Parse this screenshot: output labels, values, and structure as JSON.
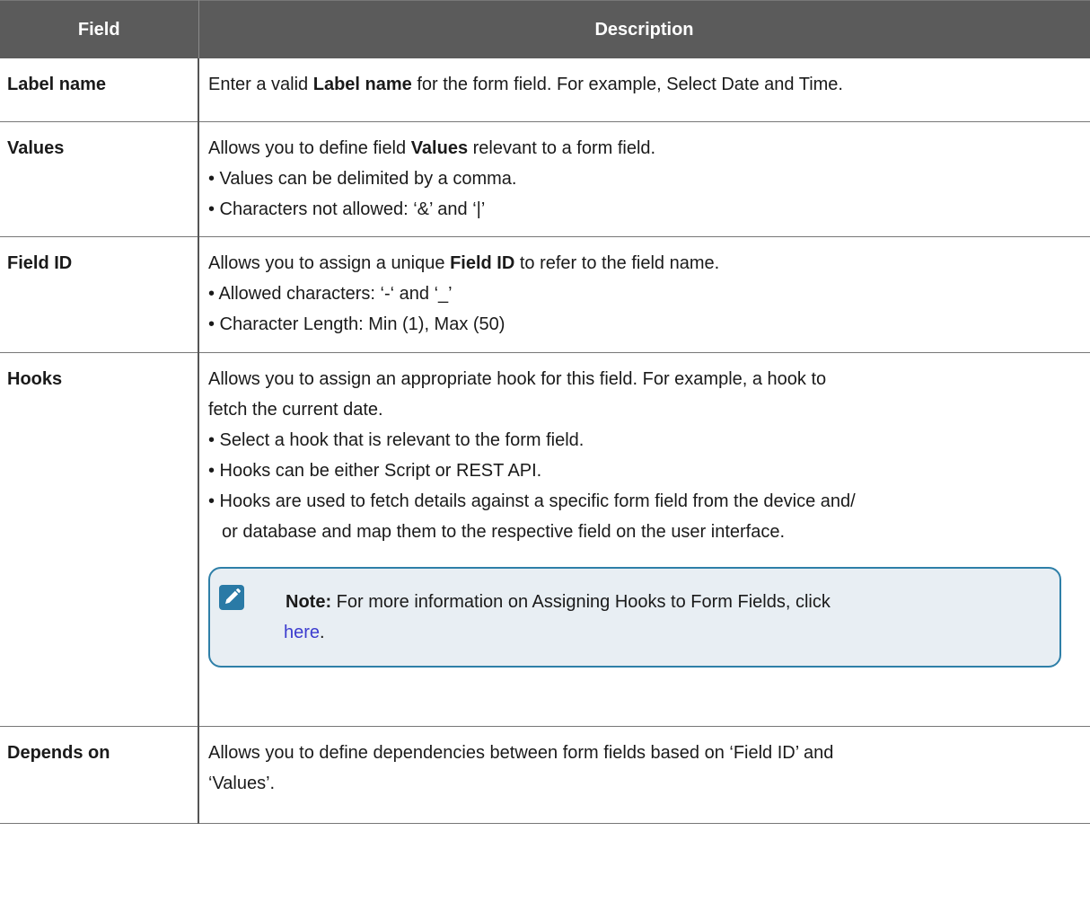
{
  "table": {
    "headers": [
      "Field",
      "Description"
    ],
    "rows": {
      "label_name": {
        "field": "Label name",
        "d_pre": "Enter a valid ",
        "d_bold": "Label name",
        "d_post": " for the form field. For example, Select Date and Time."
      },
      "values": {
        "field": "Values",
        "d_pre": "Allows you to define field ",
        "d_bold": "Values",
        "d_post": " relevant to a form field.",
        "bullets": [
          "• Values can be delimited by a comma.",
          "• Characters not allowed: ‘&’ and ‘|’"
        ]
      },
      "field_id": {
        "field": "Field ID",
        "d_pre": "Allows you to assign a unique ",
        "d_bold": "Field ID",
        "d_post": " to refer to the field name.",
        "bullets": [
          "• Allowed characters: ‘-‘ and ‘_’",
          "• Character Length: Min (1), Max (50)"
        ]
      },
      "hooks": {
        "field": "Hooks",
        "d_line1": "Allows you to assign an appropriate hook for this field. For example, a hook to",
        "d_line2": "fetch the current date.",
        "bullets": [
          "• Select a hook that is relevant to the form field.",
          "• Hooks can be either Script or REST API.",
          "• Hooks are used to fetch details against a specific form field from the device and/"
        ],
        "bullet3_cont": "or database and map them to the respective field on the user interface.",
        "note": {
          "label": "Note:",
          "text": " For more information on Assigning Hooks to Form Fields, click",
          "link": "here",
          "after_link": "."
        }
      },
      "depends_on": {
        "field": "Depends on",
        "d_line1": "Allows you to define dependencies between form fields based on ‘Field ID’ and",
        "d_line2": "‘Values’."
      }
    }
  },
  "colors": {
    "header_bg": "#5b5b5b",
    "note_border": "#2e7fa8",
    "note_bg": "#e8eef3",
    "note_icon": "#2a7aa6",
    "link": "#3c3ccf"
  },
  "icons": {
    "note": "pencil-icon"
  }
}
